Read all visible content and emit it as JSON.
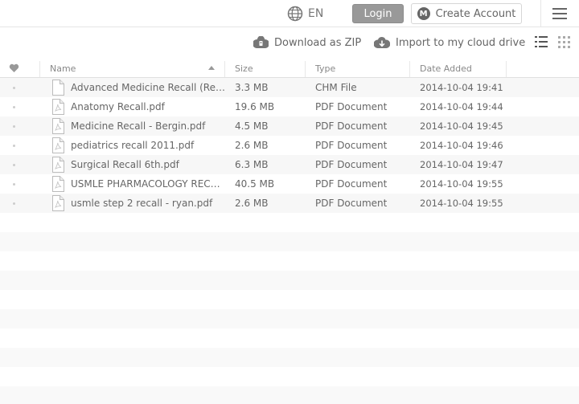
{
  "header": {
    "language": "EN",
    "login_label": "Login",
    "create_account_label": "Create Account",
    "logo_letter": "M"
  },
  "toolbar": {
    "download_zip_label": "Download as ZIP",
    "import_label": "Import to my cloud drive"
  },
  "table": {
    "columns": {
      "name": "Name",
      "size": "Size",
      "type": "Type",
      "date": "Date Added"
    },
    "rows": [
      {
        "name": "Advanced Medicine Recall (Recall…",
        "size": "3.3 MB",
        "type": "CHM File",
        "date": "2014-10-04 19:41",
        "icon": "generic-file-icon"
      },
      {
        "name": "Anatomy Recall.pdf",
        "size": "19.6 MB",
        "type": "PDF Document",
        "date": "2014-10-04 19:44",
        "icon": "pdf-file-icon"
      },
      {
        "name": "Medicine Recall - Bergin.pdf",
        "size": "4.5 MB",
        "type": "PDF Document",
        "date": "2014-10-04 19:45",
        "icon": "pdf-file-icon"
      },
      {
        "name": "pediatrics recall 2011.pdf",
        "size": "2.6 MB",
        "type": "PDF Document",
        "date": "2014-10-04 19:46",
        "icon": "pdf-file-icon"
      },
      {
        "name": "Surgical Recall 6th.pdf",
        "size": "6.3 MB",
        "type": "PDF Document",
        "date": "2014-10-04 19:47",
        "icon": "pdf-file-icon"
      },
      {
        "name": "USMLE PHARMACOLOGY RECALL.…",
        "size": "40.5 MB",
        "type": "PDF Document",
        "date": "2014-10-04 19:55",
        "icon": "pdf-file-icon"
      },
      {
        "name": "usmle step 2 recall - ryan.pdf",
        "size": "2.6 MB",
        "type": "PDF Document",
        "date": "2014-10-04 19:55",
        "icon": "pdf-file-icon"
      }
    ]
  },
  "colors": {
    "login_bg": "#999999",
    "stripe": "#f7f7f7",
    "text": "#666666"
  }
}
